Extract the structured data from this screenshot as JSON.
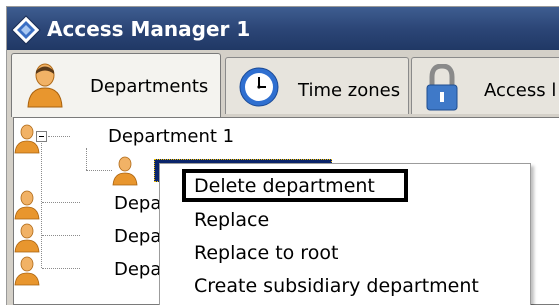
{
  "window": {
    "title": "Access Manager 1",
    "icon": "diamond-app-icon"
  },
  "tabs": [
    {
      "label": "Departments",
      "icon": "person-icon",
      "active": true
    },
    {
      "label": "Time zones",
      "icon": "clock-icon",
      "active": false
    },
    {
      "label": "Access l",
      "icon": "padlock-icon",
      "active": false
    }
  ],
  "tree": {
    "root": {
      "label": "Department 1",
      "icon": "person-icon",
      "expanded": true
    },
    "children": [
      {
        "label": "Depa",
        "icon": "person-icon"
      },
      {
        "label": "Depa",
        "icon": "person-icon"
      },
      {
        "label": "Depa",
        "icon": "person-icon"
      }
    ]
  },
  "context_menu": {
    "items": [
      {
        "label": "Delete department",
        "highlighted": true
      },
      {
        "label": "Replace"
      },
      {
        "label": "Replace to root"
      },
      {
        "label": "Create subsidiary department"
      }
    ]
  },
  "colors": {
    "titlebar": "#2c4677",
    "selection": "#0a246a",
    "person_orange": "#e8962e"
  }
}
